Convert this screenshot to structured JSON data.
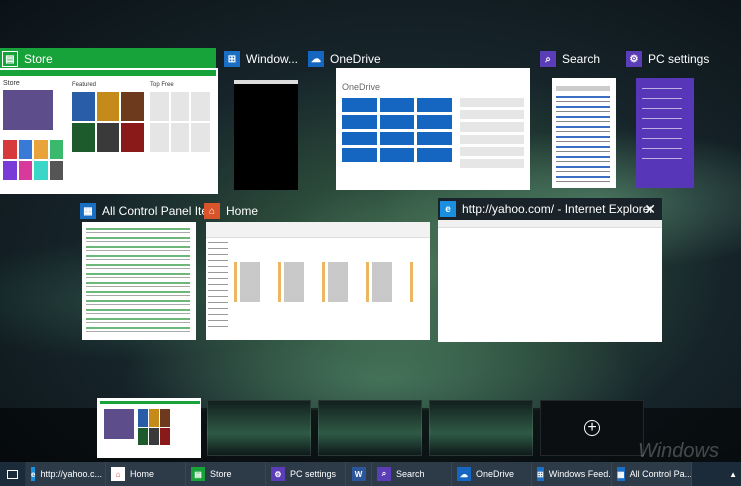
{
  "windows": {
    "store": {
      "title": "Store",
      "icon": "store-icon",
      "color": "#15a33a"
    },
    "window": {
      "title": "Window...",
      "icon": "windows-flag-icon",
      "color": "#1a6fc4"
    },
    "onedrive": {
      "title": "OneDrive",
      "icon": "cloud-icon",
      "color": "#1466c0"
    },
    "search": {
      "title": "Search",
      "icon": "search-icon",
      "color": "#5b3db8"
    },
    "pcsettings": {
      "title": "PC settings",
      "icon": "gear-icon",
      "color": "#5b3db8"
    },
    "controlpanel": {
      "title": "All Control Panel Ite...",
      "icon": "control-panel-icon",
      "color": "#1a6fc4"
    },
    "home": {
      "title": "Home",
      "icon": "home-icon",
      "color": "#d9542b"
    },
    "ie": {
      "title": "http://yahoo.com/ - Internet Explorer",
      "icon": "ie-icon",
      "color": "#1a8fe0"
    }
  },
  "store_preview": {
    "heading": "Store",
    "sub1": "Featured",
    "sub2": "Top Free"
  },
  "onedrive_preview": {
    "heading": "OneDrive"
  },
  "taskbar": {
    "items": [
      {
        "label": "http://yahoo.c...",
        "icon": "ie-icon"
      },
      {
        "label": "Home",
        "icon": "home-icon"
      },
      {
        "label": "Store",
        "icon": "store-icon"
      },
      {
        "label": "PC settings",
        "icon": "gear-icon"
      },
      {
        "label": "",
        "icon": "word-icon"
      },
      {
        "label": "Search",
        "icon": "search-icon"
      },
      {
        "label": "OneDrive",
        "icon": "cloud-icon"
      },
      {
        "label": "Windows Feed...",
        "icon": "windows-flag-icon"
      },
      {
        "label": "All Control Pa...",
        "icon": "control-panel-icon"
      }
    ]
  },
  "watermark": "Windows",
  "add_desktop_symbol": "+"
}
